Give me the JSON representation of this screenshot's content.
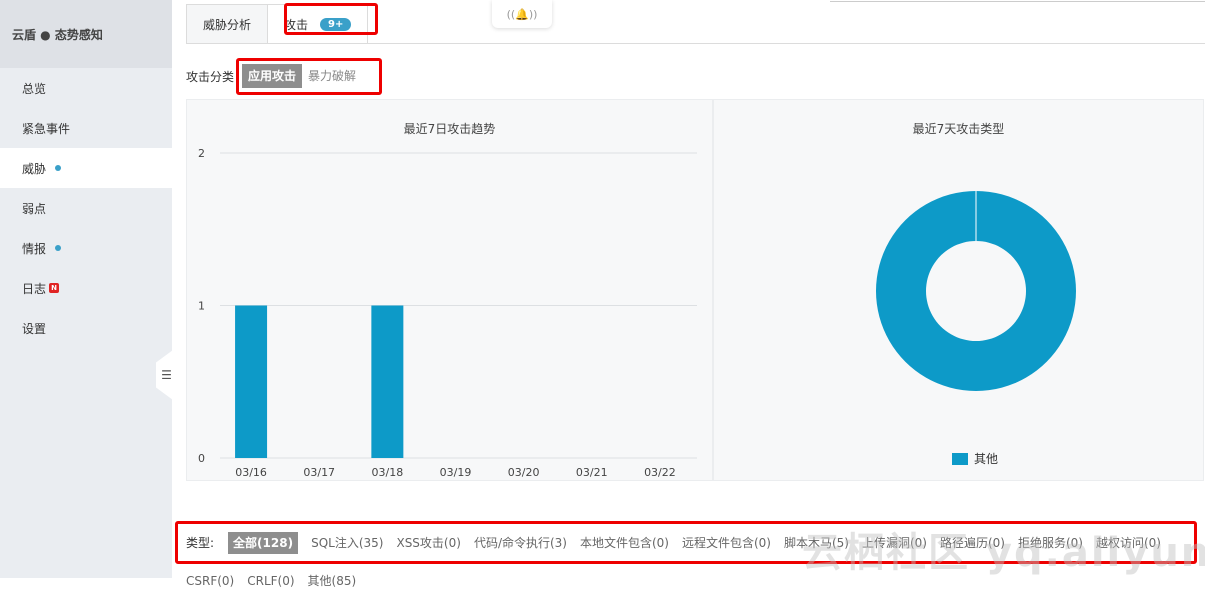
{
  "brand": "云盾 ● 态势感知",
  "nav": [
    {
      "label": "总览",
      "dot": false,
      "new": false,
      "active": false
    },
    {
      "label": "紧急事件",
      "dot": false,
      "new": false,
      "active": false
    },
    {
      "label": "威胁",
      "dot": true,
      "new": false,
      "active": true
    },
    {
      "label": "弱点",
      "dot": false,
      "new": false,
      "active": false
    },
    {
      "label": "情报",
      "dot": true,
      "new": false,
      "active": false
    },
    {
      "label": "日志",
      "dot": false,
      "new": true,
      "active": false
    },
    {
      "label": "设置",
      "dot": false,
      "new": false,
      "active": false
    }
  ],
  "new_badge": "N",
  "collapse_icon": "list-icon",
  "tabs": [
    {
      "label": "威胁分析",
      "badge": ""
    },
    {
      "label": "攻击",
      "badge": "9+"
    }
  ],
  "category": {
    "label": "攻击分类",
    "options": [
      "应用攻击",
      "暴力破解"
    ],
    "selected": "应用攻击"
  },
  "colors": {
    "accent": "#3aa0c9",
    "bar": "#0d9ac8",
    "highlight": "#e00000"
  },
  "chart_data": [
    {
      "type": "bar",
      "title": "最近7日攻击趋势",
      "categories": [
        "03/16",
        "03/17",
        "03/18",
        "03/19",
        "03/20",
        "03/21",
        "03/22"
      ],
      "values": [
        1,
        0,
        1,
        0,
        0,
        0,
        0
      ],
      "ylim": [
        0,
        2
      ],
      "yticks": [
        "0",
        "1",
        "2"
      ],
      "grid": true
    },
    {
      "type": "pie",
      "title": "最近7天攻击类型",
      "labels": [
        "其他"
      ],
      "values": [
        100
      ],
      "legend": "bottom"
    }
  ],
  "filters": {
    "label": "类型:",
    "items": [
      "全部(128)",
      "SQL注入(35)",
      "XSS攻击(0)",
      "代码/命令执行(3)",
      "本地文件包含(0)",
      "远程文件包含(0)",
      "脚本木马(5)",
      "上传漏洞(0)",
      "路径遍历(0)",
      "拒绝服务(0)",
      "越权访问(0)",
      "CSRF(0)",
      "CRLF(0)",
      "其他(85)"
    ],
    "selected": "全部(128)"
  },
  "watermark": "云栖社区 yq.aliyun.com"
}
